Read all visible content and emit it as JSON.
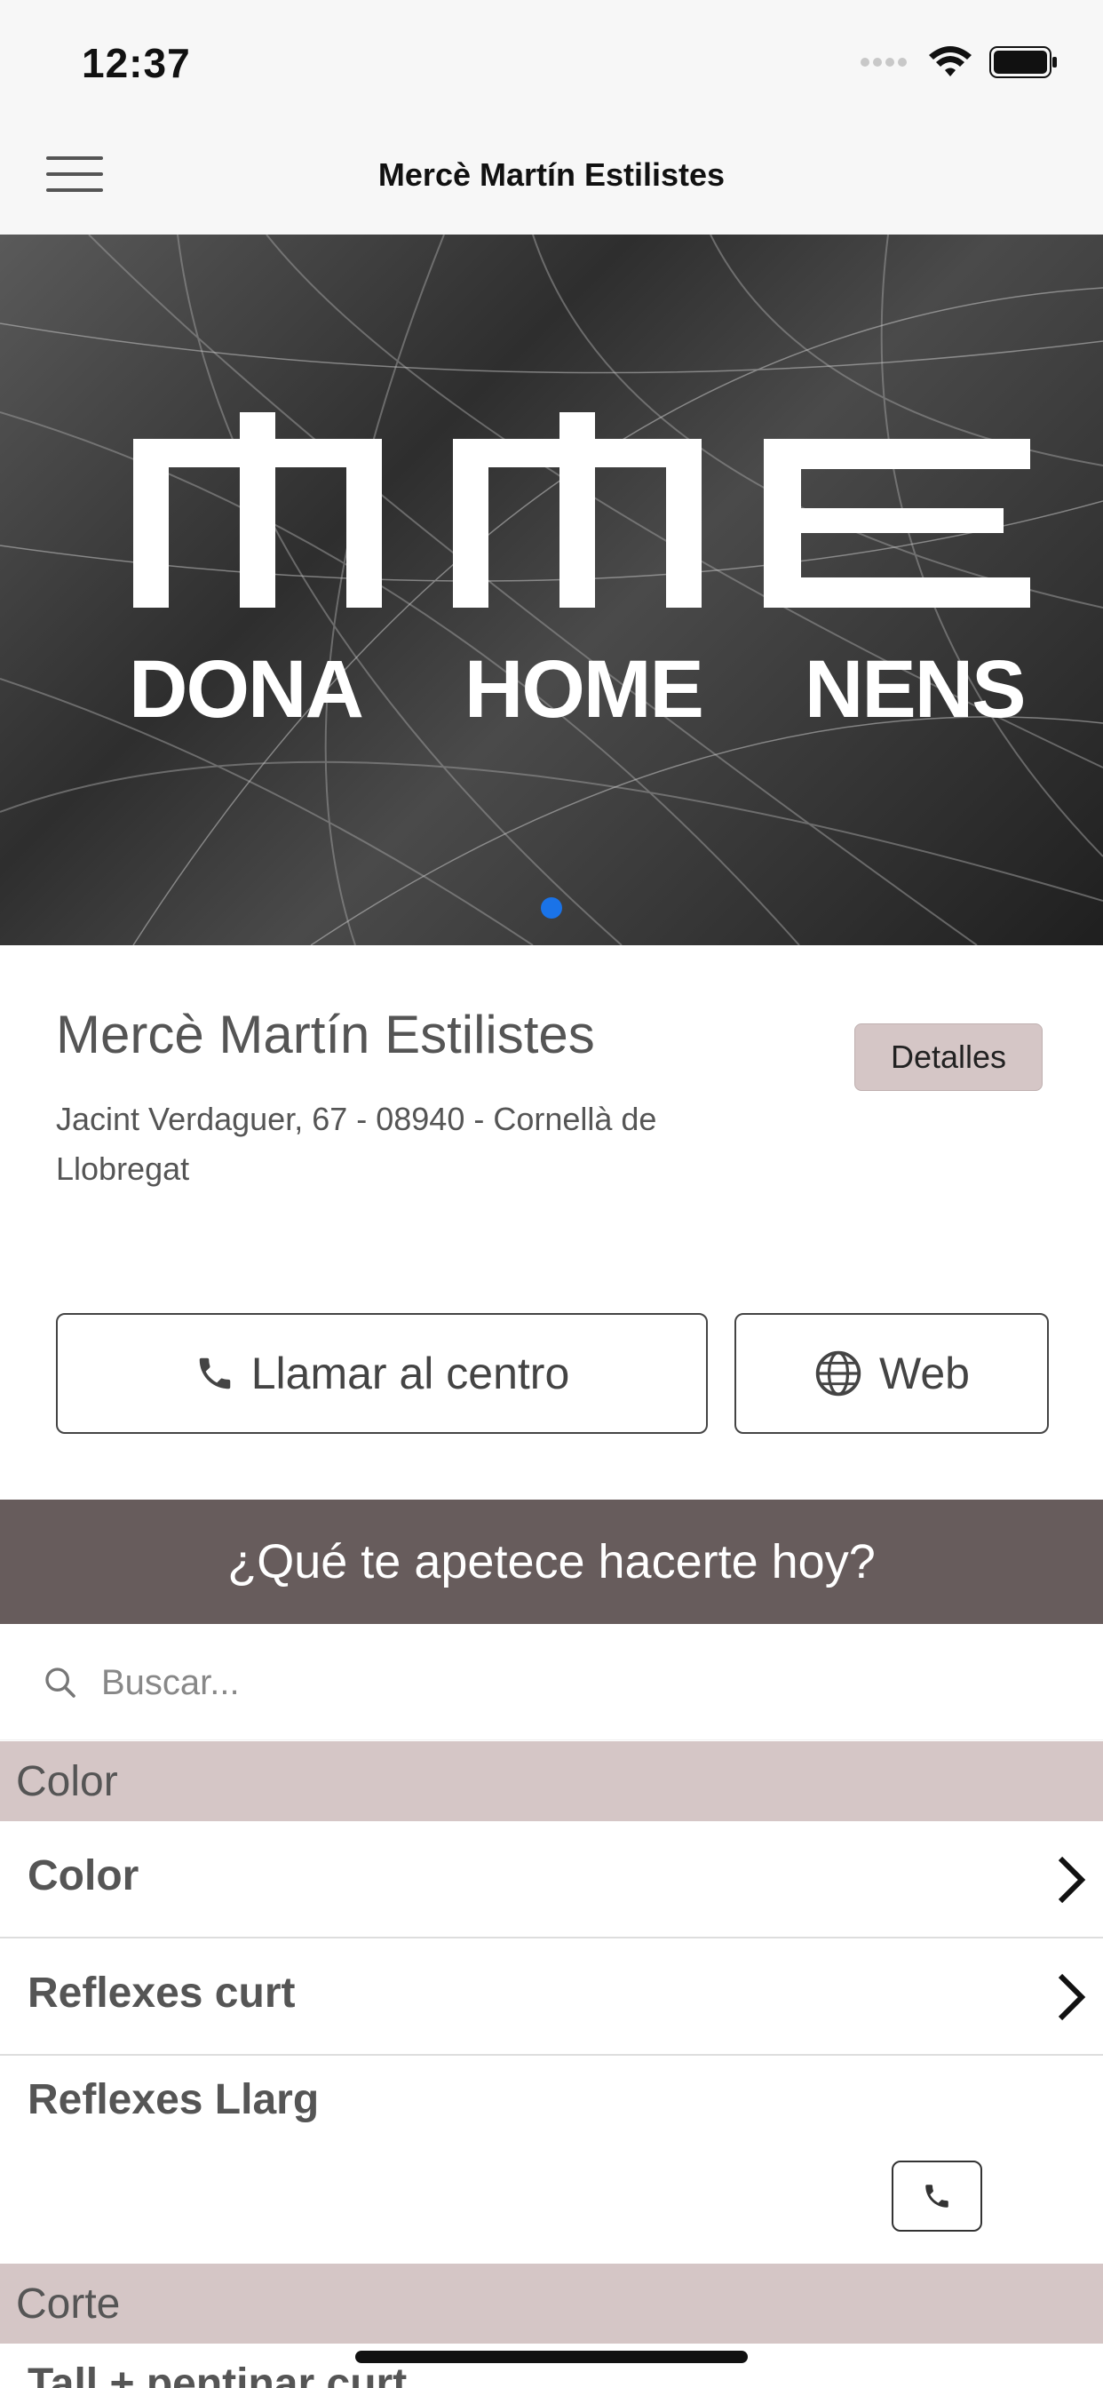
{
  "status_bar": {
    "time": "12:37"
  },
  "nav": {
    "title": "Mercè Martín Estilistes"
  },
  "hero": {
    "logo_letters": "MME",
    "sub_labels": [
      "DONA",
      "HOME",
      "NENS"
    ],
    "active_slide": 1
  },
  "salon": {
    "name": "Mercè Martín Estilistes",
    "address": "Jacint Verdaguer, 67 - 08940 - Cornellà de Llobregat",
    "details_label": "Detalles"
  },
  "actions": {
    "call_label": "Llamar al centro",
    "web_label": "Web"
  },
  "banner": {
    "text": "¿Qué te apetece hacerte hoy?"
  },
  "search": {
    "placeholder": "Buscar..."
  },
  "sections": [
    {
      "title": "Color",
      "items": [
        "Color",
        "Reflexes curt",
        "Reflexes Llarg"
      ]
    },
    {
      "title": "Corte",
      "items": [
        "Tall + pentinar curt"
      ]
    }
  ],
  "colors": {
    "accent_bar": "#675c5c",
    "section_bg": "#d5c6c6",
    "page_dot": "#1a73e8"
  }
}
